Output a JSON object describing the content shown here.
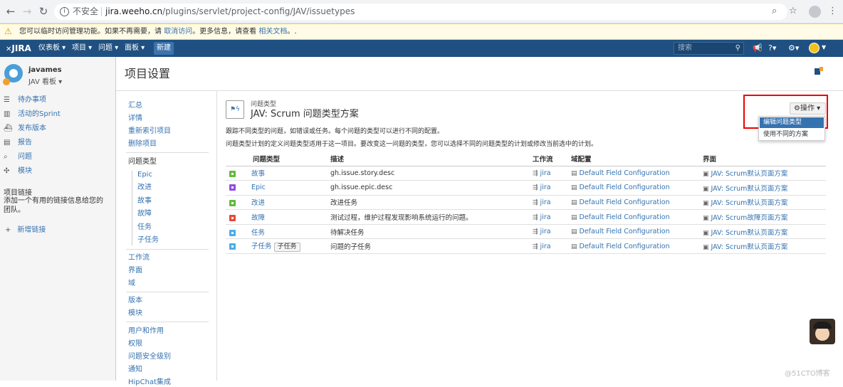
{
  "browser": {
    "security_label": "不安全",
    "url_host": "jira.weeho.cn",
    "url_path": "/plugins/servlet/project-config/JAV/issuetypes"
  },
  "warning": {
    "text_before": "您可以临时访问管理功能。如果不再需要，请",
    "link1": "取消访问",
    "text_middle": "。更多信息，请查看",
    "link2": "相关文档",
    "text_after": "。."
  },
  "topnav": {
    "logo": "JIRA",
    "menus": [
      "仪表板 ▾",
      "项目 ▾",
      "问题 ▾",
      "面板 ▾"
    ],
    "create_label": "新建",
    "search_placeholder": "搜索"
  },
  "project": {
    "name": "javames",
    "type": "JAV 看板 ▾",
    "nav": [
      "待办事项",
      "活动的Sprint",
      "发布版本",
      "报告",
      "问题",
      "模块"
    ],
    "links_title": "项目链接",
    "links_desc": "添加一个有用的链接信息给您的团队。",
    "add_link": "新增链接"
  },
  "page_title": "项目设置",
  "settings_nav": {
    "group1": [
      "汇总",
      "详情",
      "重新索引项目",
      "删除项目"
    ],
    "issue_types_title": "问题类型",
    "issue_types": [
      "Epic",
      "改进",
      "故事",
      "故障",
      "任务",
      "子任务"
    ],
    "group2": [
      "工作流",
      "界面",
      "域"
    ],
    "group3": [
      "版本",
      "模块"
    ],
    "group4": [
      "用户和作用",
      "权限",
      "问题安全级别",
      "通知",
      "HipChat集成"
    ]
  },
  "scheme": {
    "label": "问题类型",
    "name": "JAV: Scrum 问题类型方案",
    "desc1": "跟踪不同类型的问题，如错误或任务。每个问题的类型可以进行不同的配置。",
    "desc2": "问题类型计划的定义问题类型适用于这一项目。要改变这一问题的类型，您可以选择不同的问题类型的计划或修改当前选中的计划。"
  },
  "actions": {
    "button": "操作 ▾",
    "menu_edit": "编辑问题类型",
    "menu_use": "使用不同的方案"
  },
  "table": {
    "headers": [
      "问题类型",
      "描述",
      "工作流",
      "域配置",
      "界面"
    ],
    "rows": [
      {
        "type": "故事",
        "color": "#63ba3c",
        "desc": "gh.issue.story.desc",
        "workflow": "jira",
        "field": "Default Field Configuration",
        "screen": "JAV: Scrum默认页面方案"
      },
      {
        "type": "Epic",
        "color": "#904ee2",
        "desc": "gh.issue.epic.desc",
        "workflow": "jira",
        "field": "Default Field Configuration",
        "screen": "JAV: Scrum默认页面方案"
      },
      {
        "type": "改进",
        "color": "#63ba3c",
        "desc": "改进任务",
        "workflow": "jira",
        "field": "Default Field Configuration",
        "screen": "JAV: Scrum默认页面方案"
      },
      {
        "type": "故障",
        "color": "#e5493a",
        "desc": "测试过程，维护过程发现影响系统运行的问题。",
        "workflow": "jira",
        "field": "Default Field Configuration",
        "screen": "JAV: Scrum故障页面方案"
      },
      {
        "type": "任务",
        "color": "#4bade8",
        "desc": "待解决任务",
        "workflow": "jira",
        "field": "Default Field Configuration",
        "screen": "JAV: Scrum默认页面方案"
      },
      {
        "type": "子任务",
        "color": "#4bade8",
        "subtag": "子任务",
        "desc": "问题的子任务",
        "workflow": "jira",
        "field": "Default Field Configuration",
        "screen": "JAV: Scrum默认页面方案"
      }
    ]
  },
  "watermark": "@51CTO博客"
}
